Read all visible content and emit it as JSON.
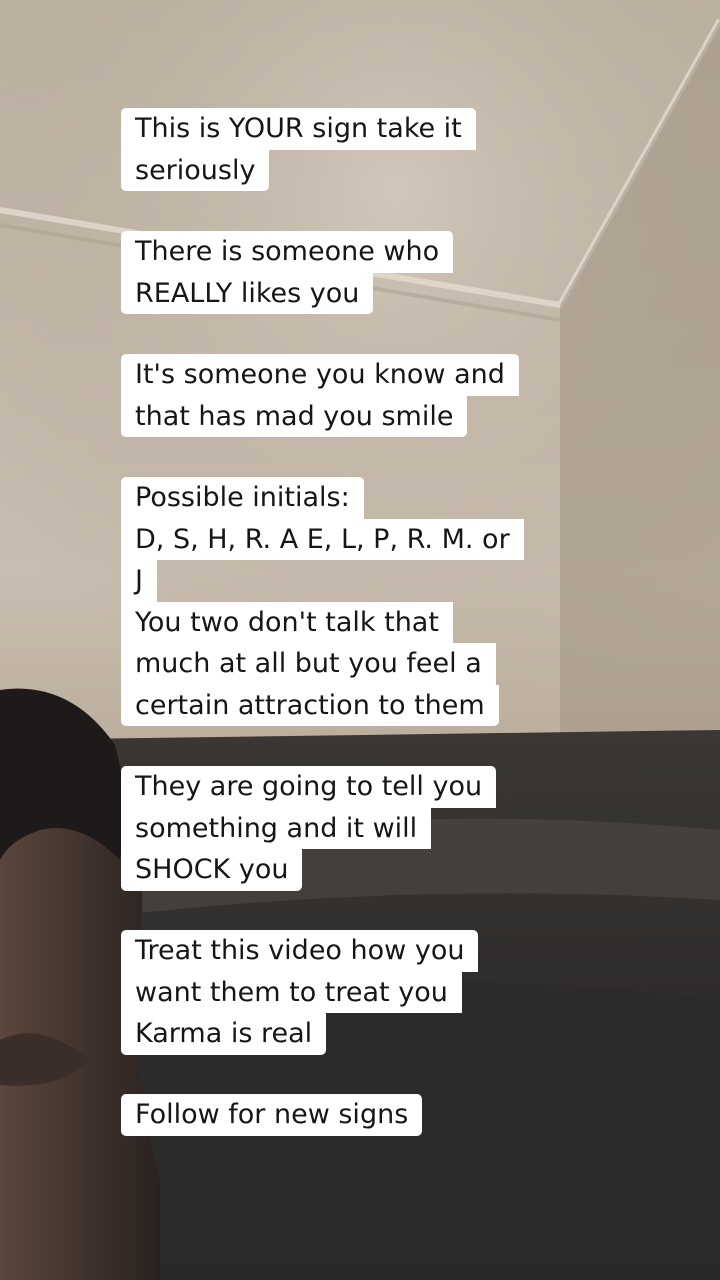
{
  "captions": [
    {
      "lines": [
        "This is YOUR sign take it",
        "seriously"
      ]
    },
    {
      "lines": [
        "There is someone who",
        "REALLY likes you"
      ]
    },
    {
      "lines": [
        "It's someone you know and",
        "that has mad you smile"
      ]
    },
    {
      "lines": [
        "Possible initials:",
        "D, S, H, R. A E, L, P, R. M. or",
        "J",
        "You two don't talk that",
        "much at all but you feel a",
        "certain attraction to them"
      ]
    },
    {
      "lines": [
        "They are going to tell you",
        "something and it will",
        "SHOCK you"
      ]
    },
    {
      "lines": [
        "Treat this video how you",
        "want them to treat you",
        "Karma is real"
      ]
    },
    {
      "lines": [
        "Follow for new signs"
      ]
    }
  ]
}
